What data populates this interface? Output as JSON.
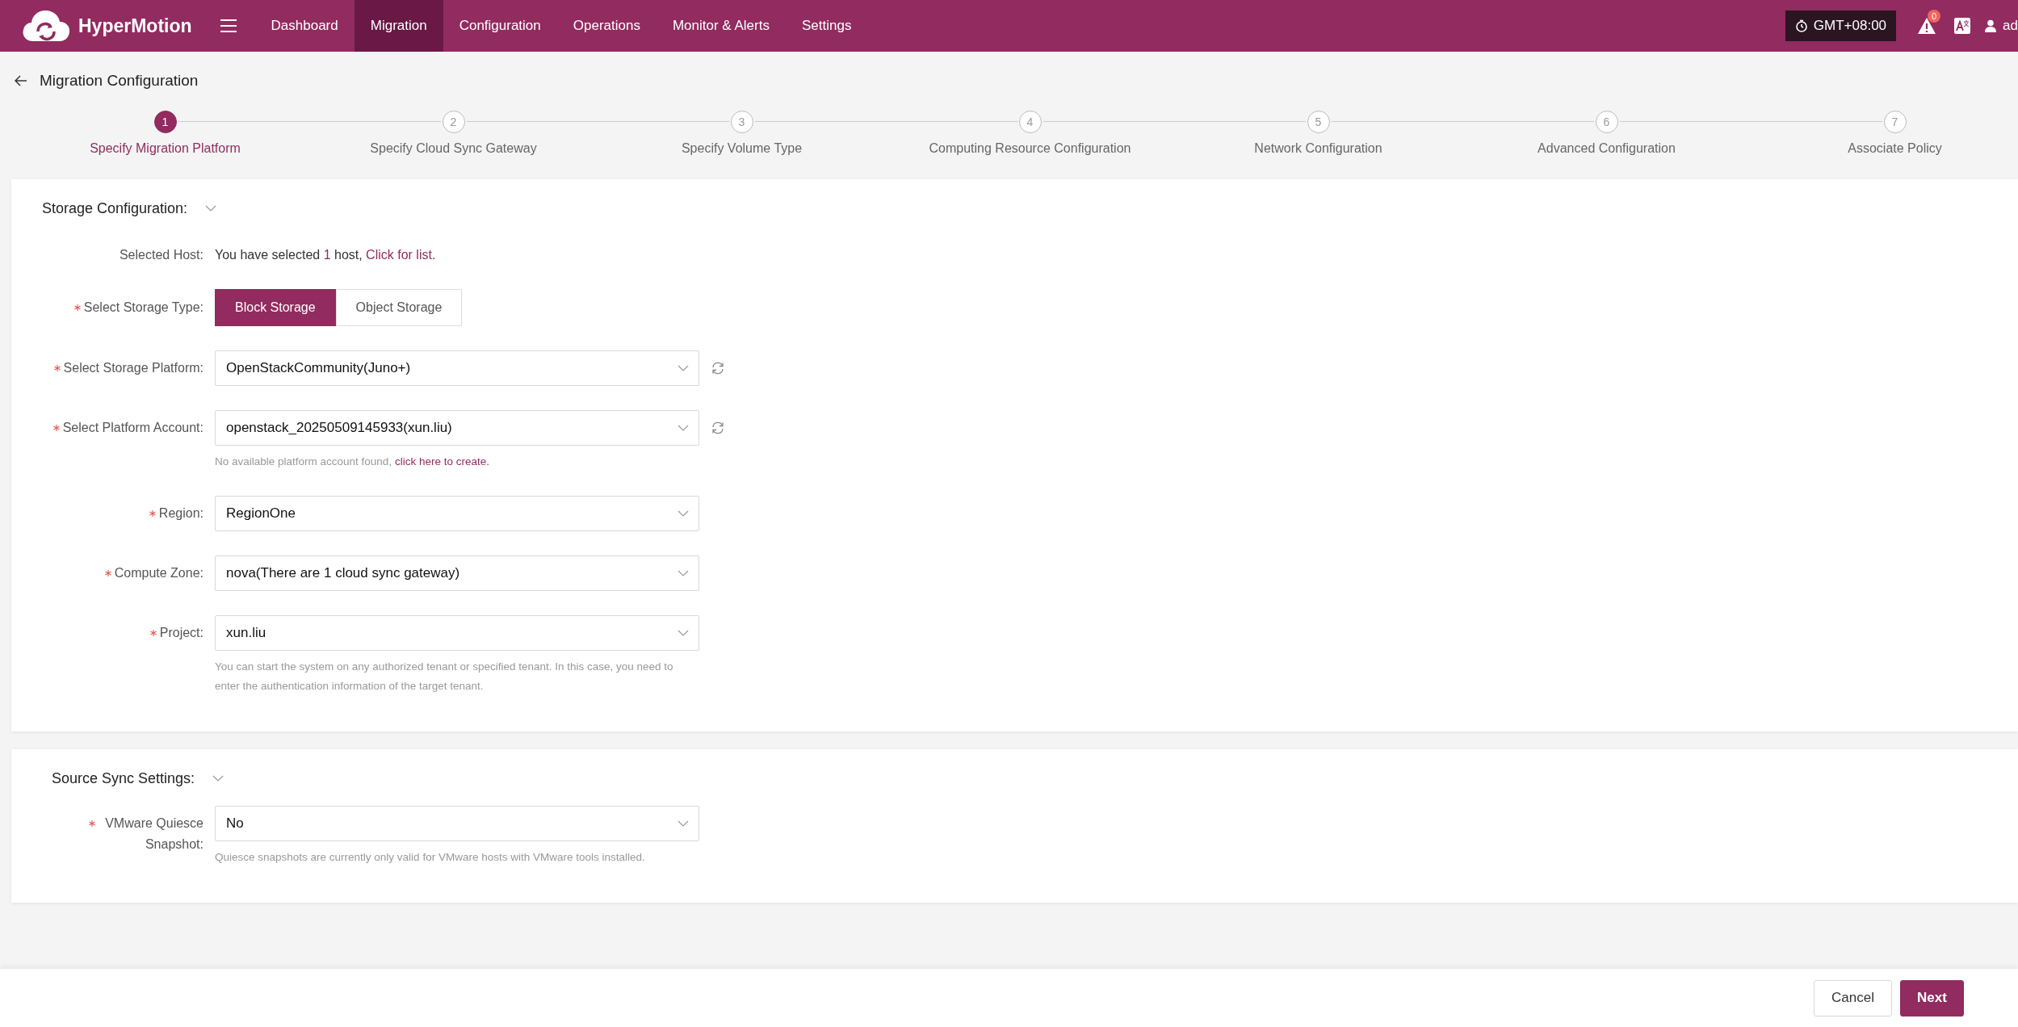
{
  "topbar": {
    "brand": "HyperMotion",
    "nav": [
      {
        "label": "Dashboard",
        "selected": false
      },
      {
        "label": "Migration",
        "selected": true
      },
      {
        "label": "Configuration",
        "selected": false
      },
      {
        "label": "Operations",
        "selected": false
      },
      {
        "label": "Monitor & Alerts",
        "selected": false
      },
      {
        "label": "Settings",
        "selected": false
      }
    ],
    "timezone": "GMT+08:00",
    "alert_count": "0",
    "user": "ad"
  },
  "page": {
    "title": "Migration Configuration"
  },
  "steps": [
    {
      "number": "1",
      "label": "Specify Migration Platform",
      "selected": true
    },
    {
      "number": "2",
      "label": "Specify Cloud Sync Gateway",
      "selected": false
    },
    {
      "number": "3",
      "label": "Specify Volume Type",
      "selected": false
    },
    {
      "number": "4",
      "label": "Computing Resource Configuration",
      "selected": false
    },
    {
      "number": "5",
      "label": "Network Configuration",
      "selected": false
    },
    {
      "number": "6",
      "label": "Advanced Configuration",
      "selected": false
    },
    {
      "number": "7",
      "label": "Associate Policy",
      "selected": false
    }
  ],
  "sections": [
    {
      "title": "Storage Configuration:",
      "expanded": true,
      "fields": [
        {
          "kind": "info",
          "label": "Selected Host:",
          "required": false,
          "text_before": "You have selected",
          "count": "1",
          "text_after": "host,",
          "link": "Click for list."
        },
        {
          "kind": "segmented",
          "label": "Select Storage Type:",
          "required": true,
          "options": [
            {
              "label": "Block Storage",
              "selected": true
            },
            {
              "label": "Object Storage",
              "selected": false
            }
          ]
        },
        {
          "kind": "select",
          "label": "Select Storage Platform:",
          "required": true,
          "value": "OpenStackCommunity(Juno+)",
          "refresh": true
        },
        {
          "kind": "select",
          "label": "Select Platform Account:",
          "required": true,
          "value": "openstack_20250509145933(xun.liu)",
          "refresh": true,
          "hint": "No available platform account found,",
          "hint_link": "click here to create."
        },
        {
          "kind": "select",
          "label": "Region:",
          "required": true,
          "value": "RegionOne",
          "refresh": false
        },
        {
          "kind": "select",
          "label": "Compute Zone:",
          "required": true,
          "value": "nova(There are 1 cloud sync gateway)",
          "refresh": false
        },
        {
          "kind": "select",
          "label": "Project:",
          "required": true,
          "value": "xun.liu",
          "refresh": false,
          "hint": "You can start the system on any authorized tenant or specified tenant. In this case, you need to enter the authentication information of the target tenant."
        }
      ]
    },
    {
      "title": "Source Sync Settings:",
      "expanded": true,
      "fields": [
        {
          "kind": "select",
          "label": "VMware Quiesce Snapshot:",
          "required": true,
          "value": "No",
          "refresh": false,
          "hint": "Quiesce snapshots are currently only valid for VMware hosts with VMware tools installed."
        }
      ]
    }
  ],
  "footer": {
    "buttons": [
      {
        "label": "Cancel",
        "kind": "secondary"
      },
      {
        "label": "Next",
        "kind": "primary"
      }
    ]
  }
}
